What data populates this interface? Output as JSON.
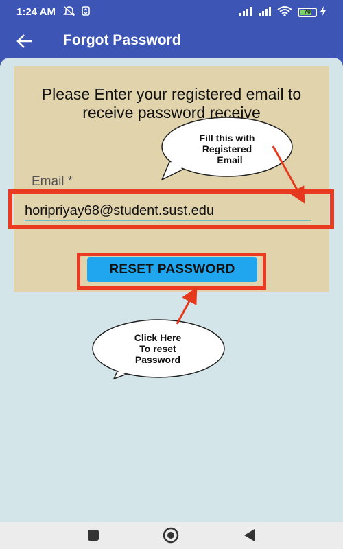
{
  "status_bar": {
    "time": "1:24 AM",
    "battery_level": "70",
    "icons": [
      "mute-icon",
      "sync-icon",
      "signal-icon",
      "signal-icon",
      "wifi-icon",
      "battery-icon",
      "charging-icon"
    ]
  },
  "app_bar": {
    "title": "Forgot Password",
    "back_icon": "arrow-left-icon"
  },
  "form": {
    "prompt": "Please Enter your registered email to receive password receive",
    "email_label": "Email *",
    "email_value": "horipriyay68@student.sust.edu",
    "reset_label": "RESET PASSWORD"
  },
  "annotations": {
    "email_callout": [
      "Fill this with",
      "Registered",
      "Email"
    ],
    "reset_callout": [
      "Click Here",
      "To reset",
      "Password"
    ]
  },
  "colors": {
    "primary": "#3d55b5",
    "background": "#d4e5ea",
    "card": "#e1d3ab",
    "highlight": "#ea3a22",
    "button": "#1fa6ee"
  },
  "nav_bar": {
    "buttons": [
      "recents-icon",
      "home-icon",
      "back-icon"
    ]
  }
}
